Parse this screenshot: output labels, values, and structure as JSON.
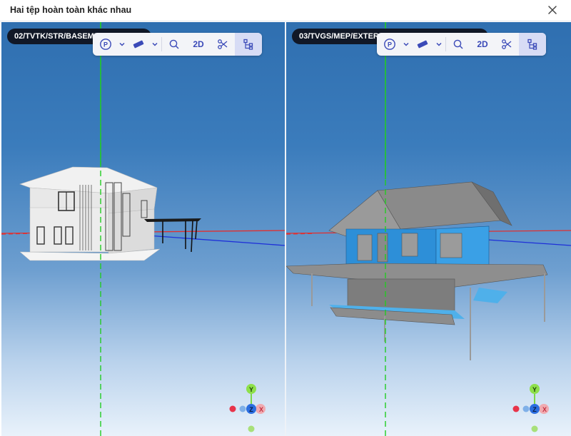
{
  "dialog": {
    "title": "Hai tệp hoàn toàn khác nhau",
    "close_icon": "close-icon"
  },
  "viewers": [
    {
      "file_label": "02/TVTK/STR/BASEMENT",
      "toolbar": {
        "projection_icon": "perspective-icon",
        "measure_icon": "ruler-icon",
        "zoom_icon": "search-icon",
        "view_2d_label": "2D",
        "section_icon": "scissors-icon",
        "tree_icon": "model-tree-icon"
      },
      "gizmo": {
        "y_label": "Y",
        "z_label": "Z",
        "x_label": "X"
      }
    },
    {
      "file_label": "03/TVGS/MEP/EXTERNAL",
      "toolbar": {
        "projection_icon": "perspective-icon",
        "measure_icon": "ruler-icon",
        "zoom_icon": "search-icon",
        "view_2d_label": "2D",
        "section_icon": "scissors-icon",
        "tree_icon": "model-tree-icon"
      },
      "gizmo": {
        "y_label": "Y",
        "z_label": "Z",
        "x_label": "X"
      }
    }
  ],
  "colors": {
    "accent": "#3b4ab8",
    "axis_y": "#22cc22",
    "axis_x": "#e03030",
    "axis_z": "#1e2fd8",
    "sky_top": "#2f6fb0",
    "sky_bottom": "#e9f2fb",
    "mep_blue": "#2d8fd8"
  }
}
